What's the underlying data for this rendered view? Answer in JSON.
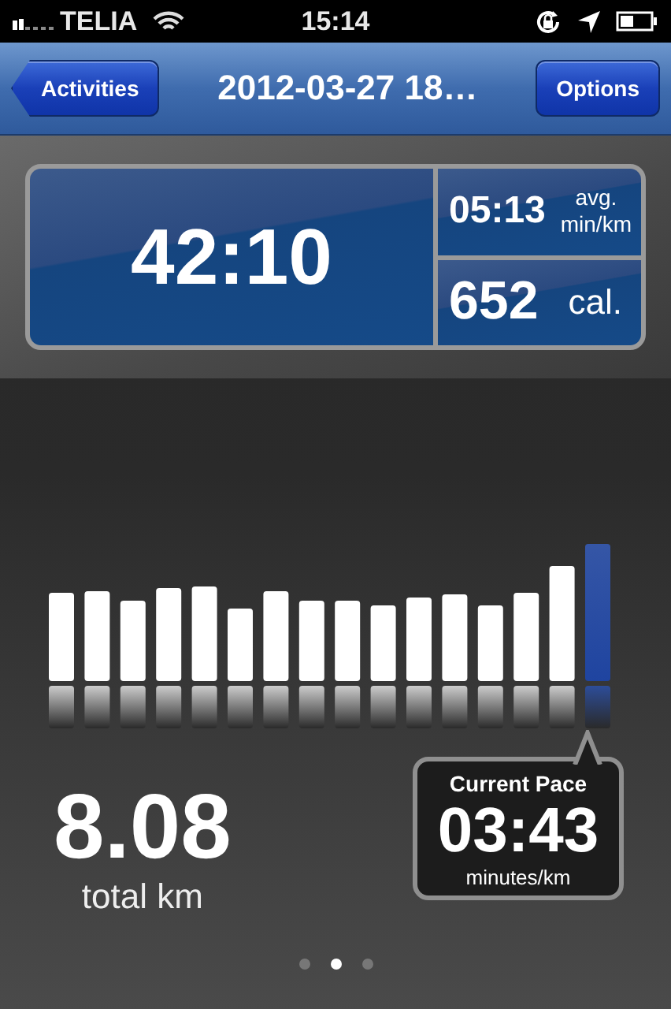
{
  "status_bar": {
    "carrier": "TELIA",
    "time": "15:14"
  },
  "nav_bar": {
    "back_button": "Activities",
    "title": "2012-03-27 18…",
    "options_button": "Options"
  },
  "summary": {
    "duration": "42:10",
    "pace": "05:13",
    "pace_unit_top": "avg.",
    "pace_unit_bottom": "min/km",
    "calories": "652",
    "calories_unit": "cal."
  },
  "splits": [
    {
      "selected": false
    },
    {
      "selected": false
    },
    {
      "selected": false
    },
    {
      "selected": false
    },
    {
      "selected": false
    },
    {
      "selected": false
    },
    {
      "selected": false
    },
    {
      "selected": false
    },
    {
      "selected": false
    },
    {
      "selected": false
    },
    {
      "selected": false
    },
    {
      "selected": false
    },
    {
      "selected": false
    },
    {
      "selected": false
    },
    {
      "selected": false
    },
    {
      "selected": true
    }
  ],
  "distance": {
    "value": "8.08",
    "unit": "total km"
  },
  "current_pace": {
    "title": "Current Pace",
    "value": "03:43",
    "unit": "minutes/km"
  },
  "page_dots": [
    {
      "selected": false
    },
    {
      "selected": true
    },
    {
      "selected": false
    }
  ]
}
